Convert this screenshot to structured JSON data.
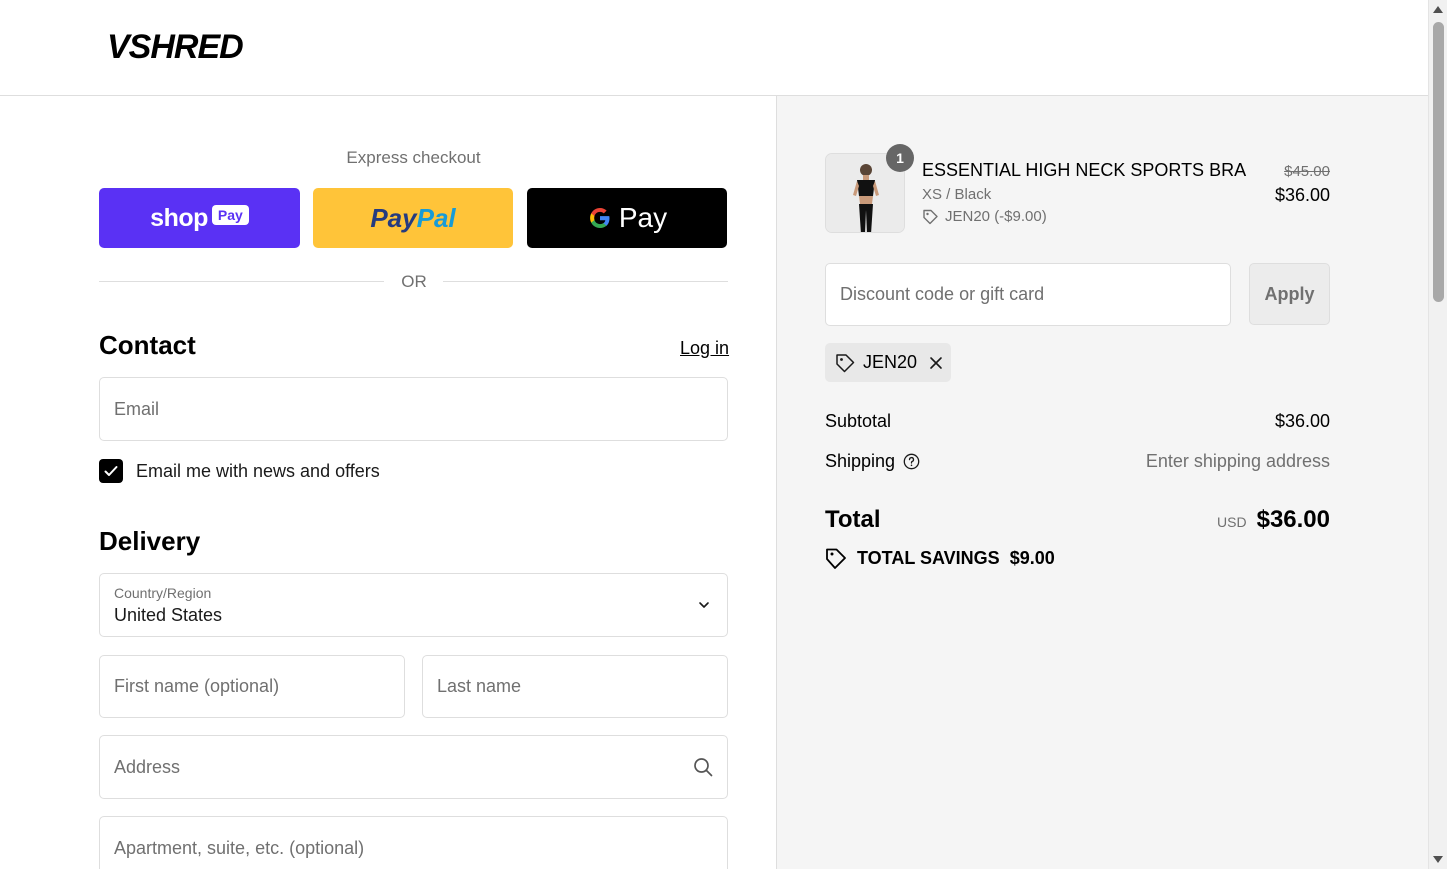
{
  "brand": {
    "logo_text": "VSHRED"
  },
  "express": {
    "title": "Express checkout",
    "shop_pay": "shop",
    "shop_pay_badge": "Pay",
    "paypal_1": "Pay",
    "paypal_2": "Pal",
    "gpay": "Pay",
    "or": "OR"
  },
  "contact": {
    "title": "Contact",
    "login": "Log in",
    "email_placeholder": "Email",
    "news_label": "Email me with news and offers",
    "news_checked": true
  },
  "delivery": {
    "title": "Delivery",
    "country_label": "Country/Region",
    "country_value": "United States",
    "first_name_placeholder": "First name (optional)",
    "last_name_placeholder": "Last name",
    "address_placeholder": "Address",
    "apartment_placeholder": "Apartment, suite, etc. (optional)"
  },
  "cart": {
    "item": {
      "quantity": "1",
      "name": "ESSENTIAL HIGH NECK SPORTS BRA",
      "variant": "XS / Black",
      "discount": "JEN20 (-$9.00)",
      "original_price": "$45.00",
      "price": "$36.00"
    },
    "discount_placeholder": "Discount code or gift card",
    "apply_label": "Apply",
    "applied_code": "JEN20",
    "subtotal_label": "Subtotal",
    "subtotal_value": "$36.00",
    "shipping_label": "Shipping",
    "shipping_value": "Enter shipping address",
    "total_label": "Total",
    "currency": "USD",
    "total_value": "$36.00",
    "savings_label": "TOTAL SAVINGS",
    "savings_value": "$9.00"
  },
  "colors": {
    "shop_pay": "#5a31f4",
    "paypal": "#ffc439",
    "gpay": "#000000",
    "summary_bg": "#f5f5f5"
  }
}
